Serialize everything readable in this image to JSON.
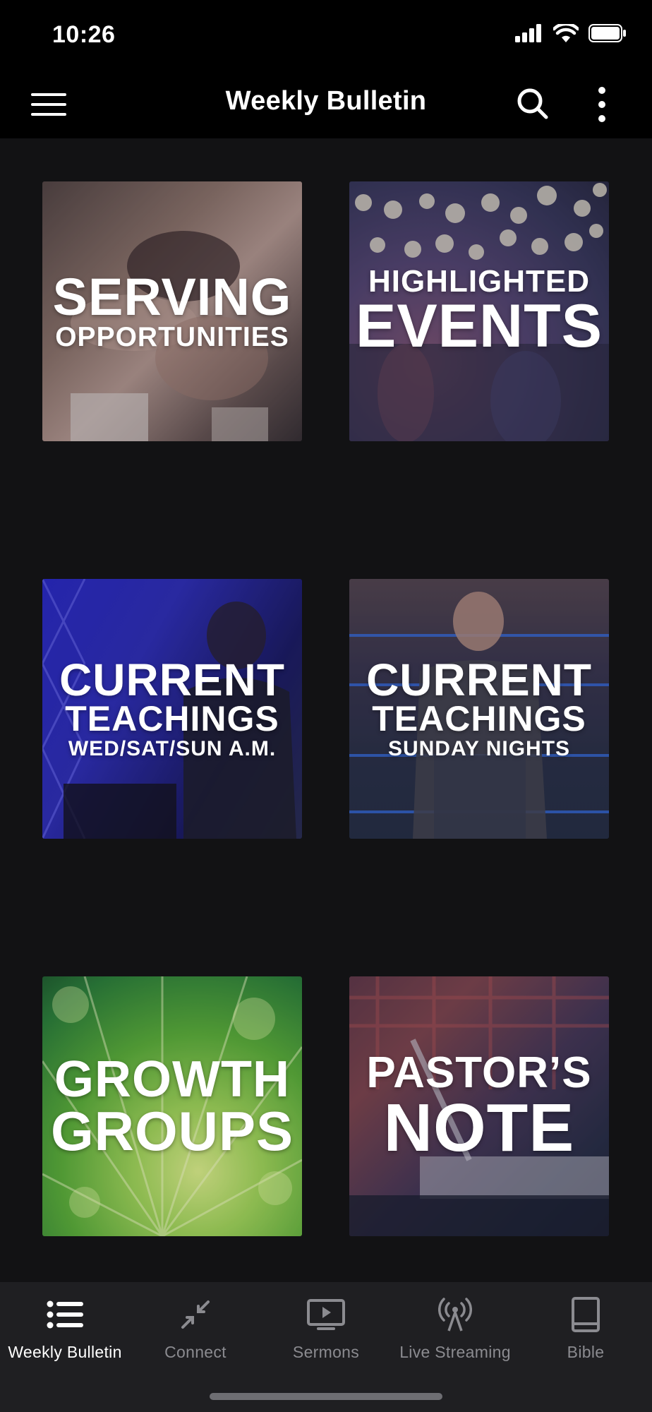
{
  "status_bar": {
    "time": "10:26"
  },
  "header": {
    "title": "Weekly Bulletin",
    "menu_icon": "hamburger-menu-icon",
    "search_icon": "search-icon",
    "more_icon": "more-vertical-icon"
  },
  "tiles": [
    {
      "lines": [
        "SERVING",
        "OPPORTUNITIES"
      ]
    },
    {
      "lines": [
        "HIGHLIGHTED",
        "EVENTS"
      ]
    },
    {
      "lines": [
        "CURRENT",
        "TEACHINGS",
        "WED/SAT/SUN A.M."
      ]
    },
    {
      "lines": [
        "CURRENT",
        "TEACHINGS",
        "SUNDAY NIGHTS"
      ]
    },
    {
      "lines": [
        "GROWTH",
        "GROUPS"
      ]
    },
    {
      "lines": [
        "PASTOR’S",
        "NOTE"
      ]
    }
  ],
  "tab_bar": {
    "items": [
      {
        "label": "Weekly Bulletin",
        "icon": "list-icon",
        "active": true
      },
      {
        "label": "Connect",
        "icon": "connect-arrows-icon",
        "active": false
      },
      {
        "label": "Sermons",
        "icon": "video-play-icon",
        "active": false
      },
      {
        "label": "Live Streaming",
        "icon": "broadcast-icon",
        "active": false
      },
      {
        "label": "Bible",
        "icon": "book-icon",
        "active": false
      }
    ]
  },
  "colors": {
    "background": "#121214",
    "header": "#000000",
    "tab_bar": "#1f1f22",
    "tab_active": "#ffffff",
    "tab_inactive": "#8b8b90"
  }
}
